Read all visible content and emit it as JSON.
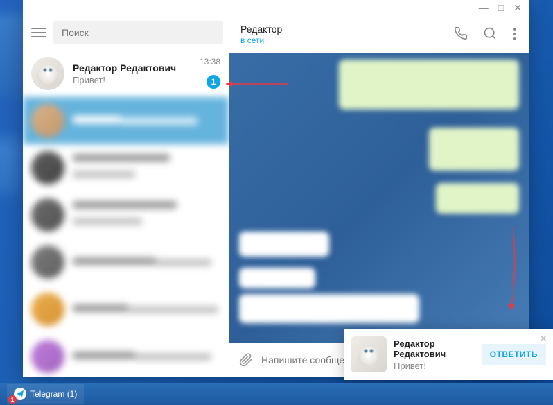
{
  "search_placeholder": "Поиск",
  "chat": {
    "name": "Редактор Редактович",
    "preview": "Привет!",
    "time": "13:38",
    "unread": "1"
  },
  "header": {
    "name": "Редактор",
    "status": "в сети"
  },
  "input_placeholder": "Напишите сообщение...",
  "popup": {
    "name": "Редактор Редактович",
    "msg": "Привет!",
    "reply": "ОТВЕТИТЬ"
  },
  "taskbar": {
    "label": "Telegram (1)",
    "badge": "1"
  },
  "window": {
    "min": "—",
    "max": "□",
    "close": "✕"
  }
}
